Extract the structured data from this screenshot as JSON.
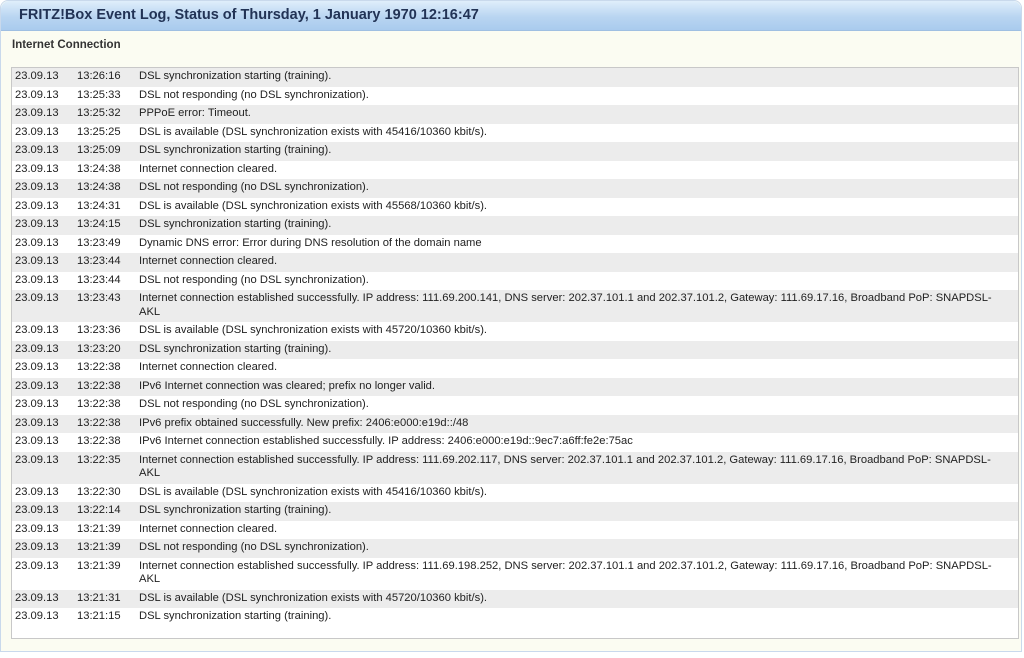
{
  "window": {
    "title": "FRITZ!Box Event Log, Status of Thursday, 1 January 1970 12:16:47"
  },
  "section": {
    "title": "Internet Connection"
  },
  "log": [
    {
      "date": "23.09.13",
      "time": "13:26:16",
      "message": "DSL synchronization starting (training)."
    },
    {
      "date": "23.09.13",
      "time": "13:25:33",
      "message": "DSL not responding (no DSL synchronization)."
    },
    {
      "date": "23.09.13",
      "time": "13:25:32",
      "message": "PPPoE error: Timeout."
    },
    {
      "date": "23.09.13",
      "time": "13:25:25",
      "message": "DSL is available (DSL synchronization exists with 45416/10360 kbit/s)."
    },
    {
      "date": "23.09.13",
      "time": "13:25:09",
      "message": "DSL synchronization starting (training)."
    },
    {
      "date": "23.09.13",
      "time": "13:24:38",
      "message": "Internet connection cleared."
    },
    {
      "date": "23.09.13",
      "time": "13:24:38",
      "message": "DSL not responding (no DSL synchronization)."
    },
    {
      "date": "23.09.13",
      "time": "13:24:31",
      "message": "DSL is available (DSL synchronization exists with 45568/10360 kbit/s)."
    },
    {
      "date": "23.09.13",
      "time": "13:24:15",
      "message": "DSL synchronization starting (training)."
    },
    {
      "date": "23.09.13",
      "time": "13:23:49",
      "message": "Dynamic DNS error: Error during DNS resolution of the domain name"
    },
    {
      "date": "23.09.13",
      "time": "13:23:44",
      "message": "Internet connection cleared."
    },
    {
      "date": "23.09.13",
      "time": "13:23:44",
      "message": "DSL not responding (no DSL synchronization)."
    },
    {
      "date": "23.09.13",
      "time": "13:23:43",
      "message": "Internet connection established successfully. IP address: 111.69.200.141, DNS server: 202.37.101.1 and 202.37.101.2, Gateway: 111.69.17.16, Broadband PoP: SNAPDSL-AKL"
    },
    {
      "date": "23.09.13",
      "time": "13:23:36",
      "message": "DSL is available (DSL synchronization exists with 45720/10360 kbit/s)."
    },
    {
      "date": "23.09.13",
      "time": "13:23:20",
      "message": "DSL synchronization starting (training)."
    },
    {
      "date": "23.09.13",
      "time": "13:22:38",
      "message": "Internet connection cleared."
    },
    {
      "date": "23.09.13",
      "time": "13:22:38",
      "message": "IPv6 Internet connection was cleared; prefix no longer valid."
    },
    {
      "date": "23.09.13",
      "time": "13:22:38",
      "message": "DSL not responding (no DSL synchronization)."
    },
    {
      "date": "23.09.13",
      "time": "13:22:38",
      "message": "IPv6 prefix obtained successfully. New prefix: 2406:e000:e19d::/48"
    },
    {
      "date": "23.09.13",
      "time": "13:22:38",
      "message": "IPv6 Internet connection established successfully. IP address: 2406:e000:e19d::9ec7:a6ff:fe2e:75ac"
    },
    {
      "date": "23.09.13",
      "time": "13:22:35",
      "message": "Internet connection established successfully. IP address: 111.69.202.117, DNS server: 202.37.101.1 and 202.37.101.2, Gateway: 111.69.17.16, Broadband PoP: SNAPDSL-AKL"
    },
    {
      "date": "23.09.13",
      "time": "13:22:30",
      "message": "DSL is available (DSL synchronization exists with 45416/10360 kbit/s)."
    },
    {
      "date": "23.09.13",
      "time": "13:22:14",
      "message": "DSL synchronization starting (training)."
    },
    {
      "date": "23.09.13",
      "time": "13:21:39",
      "message": "Internet connection cleared."
    },
    {
      "date": "23.09.13",
      "time": "13:21:39",
      "message": "DSL not responding (no DSL synchronization)."
    },
    {
      "date": "23.09.13",
      "time": "13:21:39",
      "message": "Internet connection established successfully. IP address: 111.69.198.252, DNS server: 202.37.101.1 and 202.37.101.2, Gateway: 111.69.17.16, Broadband PoP: SNAPDSL-AKL"
    },
    {
      "date": "23.09.13",
      "time": "13:21:31",
      "message": "DSL is available (DSL synchronization exists with 45720/10360 kbit/s)."
    },
    {
      "date": "23.09.13",
      "time": "13:21:15",
      "message": "DSL synchronization starting (training)."
    }
  ]
}
